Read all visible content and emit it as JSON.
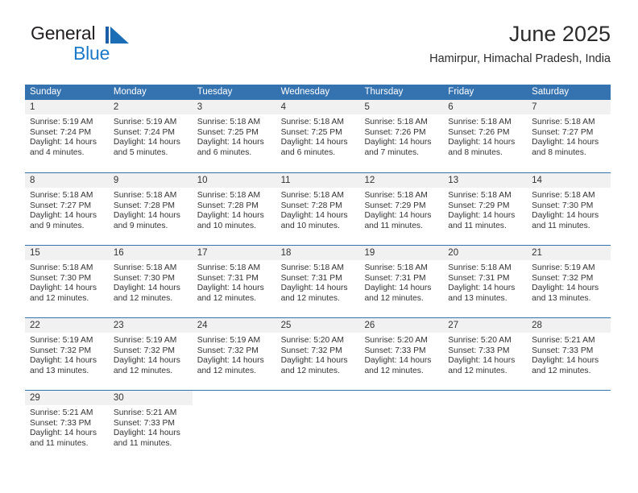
{
  "brand": {
    "name_part1": "General",
    "name_part2": "Blue",
    "mark_icon": "triangle-flag-icon",
    "accent_color": "#1b79c9"
  },
  "header": {
    "title": "June 2025",
    "subtitle": "Hamirpur, Himachal Pradesh, India"
  },
  "theme": {
    "header_blue": "#3572b0",
    "day_band_gray": "#f1f1f1",
    "text_color": "#333333"
  },
  "weekdays": [
    "Sunday",
    "Monday",
    "Tuesday",
    "Wednesday",
    "Thursday",
    "Friday",
    "Saturday"
  ],
  "weeks": [
    [
      {
        "day": "1",
        "sunrise": "Sunrise: 5:19 AM",
        "sunset": "Sunset: 7:24 PM",
        "daylight1": "Daylight: 14 hours",
        "daylight2": "and 4 minutes."
      },
      {
        "day": "2",
        "sunrise": "Sunrise: 5:19 AM",
        "sunset": "Sunset: 7:24 PM",
        "daylight1": "Daylight: 14 hours",
        "daylight2": "and 5 minutes."
      },
      {
        "day": "3",
        "sunrise": "Sunrise: 5:18 AM",
        "sunset": "Sunset: 7:25 PM",
        "daylight1": "Daylight: 14 hours",
        "daylight2": "and 6 minutes."
      },
      {
        "day": "4",
        "sunrise": "Sunrise: 5:18 AM",
        "sunset": "Sunset: 7:25 PM",
        "daylight1": "Daylight: 14 hours",
        "daylight2": "and 6 minutes."
      },
      {
        "day": "5",
        "sunrise": "Sunrise: 5:18 AM",
        "sunset": "Sunset: 7:26 PM",
        "daylight1": "Daylight: 14 hours",
        "daylight2": "and 7 minutes."
      },
      {
        "day": "6",
        "sunrise": "Sunrise: 5:18 AM",
        "sunset": "Sunset: 7:26 PM",
        "daylight1": "Daylight: 14 hours",
        "daylight2": "and 8 minutes."
      },
      {
        "day": "7",
        "sunrise": "Sunrise: 5:18 AM",
        "sunset": "Sunset: 7:27 PM",
        "daylight1": "Daylight: 14 hours",
        "daylight2": "and 8 minutes."
      }
    ],
    [
      {
        "day": "8",
        "sunrise": "Sunrise: 5:18 AM",
        "sunset": "Sunset: 7:27 PM",
        "daylight1": "Daylight: 14 hours",
        "daylight2": "and 9 minutes."
      },
      {
        "day": "9",
        "sunrise": "Sunrise: 5:18 AM",
        "sunset": "Sunset: 7:28 PM",
        "daylight1": "Daylight: 14 hours",
        "daylight2": "and 9 minutes."
      },
      {
        "day": "10",
        "sunrise": "Sunrise: 5:18 AM",
        "sunset": "Sunset: 7:28 PM",
        "daylight1": "Daylight: 14 hours",
        "daylight2": "and 10 minutes."
      },
      {
        "day": "11",
        "sunrise": "Sunrise: 5:18 AM",
        "sunset": "Sunset: 7:28 PM",
        "daylight1": "Daylight: 14 hours",
        "daylight2": "and 10 minutes."
      },
      {
        "day": "12",
        "sunrise": "Sunrise: 5:18 AM",
        "sunset": "Sunset: 7:29 PM",
        "daylight1": "Daylight: 14 hours",
        "daylight2": "and 11 minutes."
      },
      {
        "day": "13",
        "sunrise": "Sunrise: 5:18 AM",
        "sunset": "Sunset: 7:29 PM",
        "daylight1": "Daylight: 14 hours",
        "daylight2": "and 11 minutes."
      },
      {
        "day": "14",
        "sunrise": "Sunrise: 5:18 AM",
        "sunset": "Sunset: 7:30 PM",
        "daylight1": "Daylight: 14 hours",
        "daylight2": "and 11 minutes."
      }
    ],
    [
      {
        "day": "15",
        "sunrise": "Sunrise: 5:18 AM",
        "sunset": "Sunset: 7:30 PM",
        "daylight1": "Daylight: 14 hours",
        "daylight2": "and 12 minutes."
      },
      {
        "day": "16",
        "sunrise": "Sunrise: 5:18 AM",
        "sunset": "Sunset: 7:30 PM",
        "daylight1": "Daylight: 14 hours",
        "daylight2": "and 12 minutes."
      },
      {
        "day": "17",
        "sunrise": "Sunrise: 5:18 AM",
        "sunset": "Sunset: 7:31 PM",
        "daylight1": "Daylight: 14 hours",
        "daylight2": "and 12 minutes."
      },
      {
        "day": "18",
        "sunrise": "Sunrise: 5:18 AM",
        "sunset": "Sunset: 7:31 PM",
        "daylight1": "Daylight: 14 hours",
        "daylight2": "and 12 minutes."
      },
      {
        "day": "19",
        "sunrise": "Sunrise: 5:18 AM",
        "sunset": "Sunset: 7:31 PM",
        "daylight1": "Daylight: 14 hours",
        "daylight2": "and 12 minutes."
      },
      {
        "day": "20",
        "sunrise": "Sunrise: 5:18 AM",
        "sunset": "Sunset: 7:31 PM",
        "daylight1": "Daylight: 14 hours",
        "daylight2": "and 13 minutes."
      },
      {
        "day": "21",
        "sunrise": "Sunrise: 5:19 AM",
        "sunset": "Sunset: 7:32 PM",
        "daylight1": "Daylight: 14 hours",
        "daylight2": "and 13 minutes."
      }
    ],
    [
      {
        "day": "22",
        "sunrise": "Sunrise: 5:19 AM",
        "sunset": "Sunset: 7:32 PM",
        "daylight1": "Daylight: 14 hours",
        "daylight2": "and 13 minutes."
      },
      {
        "day": "23",
        "sunrise": "Sunrise: 5:19 AM",
        "sunset": "Sunset: 7:32 PM",
        "daylight1": "Daylight: 14 hours",
        "daylight2": "and 12 minutes."
      },
      {
        "day": "24",
        "sunrise": "Sunrise: 5:19 AM",
        "sunset": "Sunset: 7:32 PM",
        "daylight1": "Daylight: 14 hours",
        "daylight2": "and 12 minutes."
      },
      {
        "day": "25",
        "sunrise": "Sunrise: 5:20 AM",
        "sunset": "Sunset: 7:32 PM",
        "daylight1": "Daylight: 14 hours",
        "daylight2": "and 12 minutes."
      },
      {
        "day": "26",
        "sunrise": "Sunrise: 5:20 AM",
        "sunset": "Sunset: 7:33 PM",
        "daylight1": "Daylight: 14 hours",
        "daylight2": "and 12 minutes."
      },
      {
        "day": "27",
        "sunrise": "Sunrise: 5:20 AM",
        "sunset": "Sunset: 7:33 PM",
        "daylight1": "Daylight: 14 hours",
        "daylight2": "and 12 minutes."
      },
      {
        "day": "28",
        "sunrise": "Sunrise: 5:21 AM",
        "sunset": "Sunset: 7:33 PM",
        "daylight1": "Daylight: 14 hours",
        "daylight2": "and 12 minutes."
      }
    ],
    [
      {
        "day": "29",
        "sunrise": "Sunrise: 5:21 AM",
        "sunset": "Sunset: 7:33 PM",
        "daylight1": "Daylight: 14 hours",
        "daylight2": "and 11 minutes."
      },
      {
        "day": "30",
        "sunrise": "Sunrise: 5:21 AM",
        "sunset": "Sunset: 7:33 PM",
        "daylight1": "Daylight: 14 hours",
        "daylight2": "and 11 minutes."
      },
      {
        "day": "",
        "sunrise": "",
        "sunset": "",
        "daylight1": "",
        "daylight2": ""
      },
      {
        "day": "",
        "sunrise": "",
        "sunset": "",
        "daylight1": "",
        "daylight2": ""
      },
      {
        "day": "",
        "sunrise": "",
        "sunset": "",
        "daylight1": "",
        "daylight2": ""
      },
      {
        "day": "",
        "sunrise": "",
        "sunset": "",
        "daylight1": "",
        "daylight2": ""
      },
      {
        "day": "",
        "sunrise": "",
        "sunset": "",
        "daylight1": "",
        "daylight2": ""
      }
    ]
  ]
}
